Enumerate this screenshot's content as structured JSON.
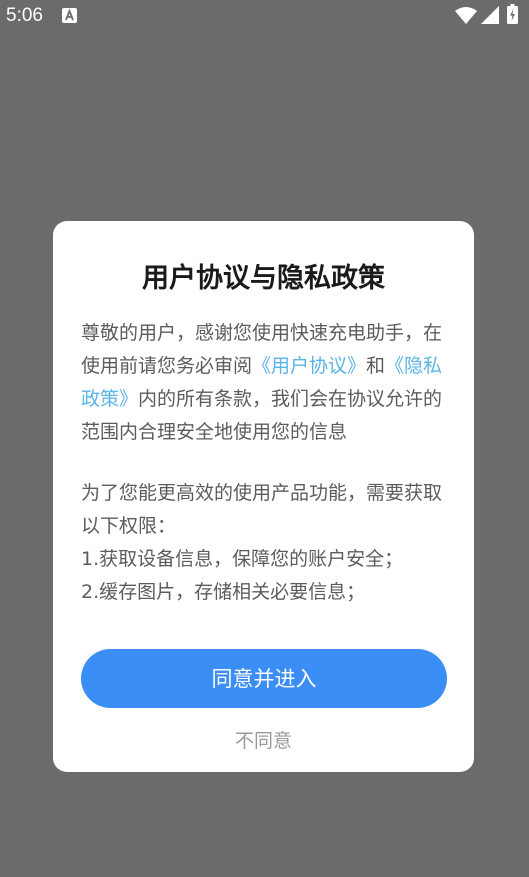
{
  "status_bar": {
    "time": "5:06",
    "notification_icon": "a-letter-icon",
    "wifi_icon": "wifi-icon",
    "signal_icon": "signal-icon",
    "battery_icon": "battery-charging-icon"
  },
  "dialog": {
    "title": "用户协议与隐私政策",
    "paragraph1": {
      "text_before": "尊敬的用户，感谢您使用快速充电助手，在使用前请您务必审阅",
      "user_agreement_link": "《用户协议》",
      "text_and": "和",
      "privacy_policy_link": "《隐私政策》",
      "text_after": "内的所有条款，我们会在协议允许的范围内合理安全地使用您的信息"
    },
    "paragraph2": "为了您能更高效的使用产品功能，需要获取以下权限：",
    "permission1": "1.获取设备信息，保障您的账户安全；",
    "permission2": "2.缓存图片，存储相关必要信息；",
    "agree_label": "同意并进入",
    "disagree_label": "不同意"
  },
  "colors": {
    "overlay": "#6b6b6b",
    "primary_button": "#3a8ef6",
    "link": "#5ab4e8",
    "body_text": "#5c5c5c",
    "title_text": "#1a1a1a",
    "secondary_text": "#9a9a9a"
  }
}
